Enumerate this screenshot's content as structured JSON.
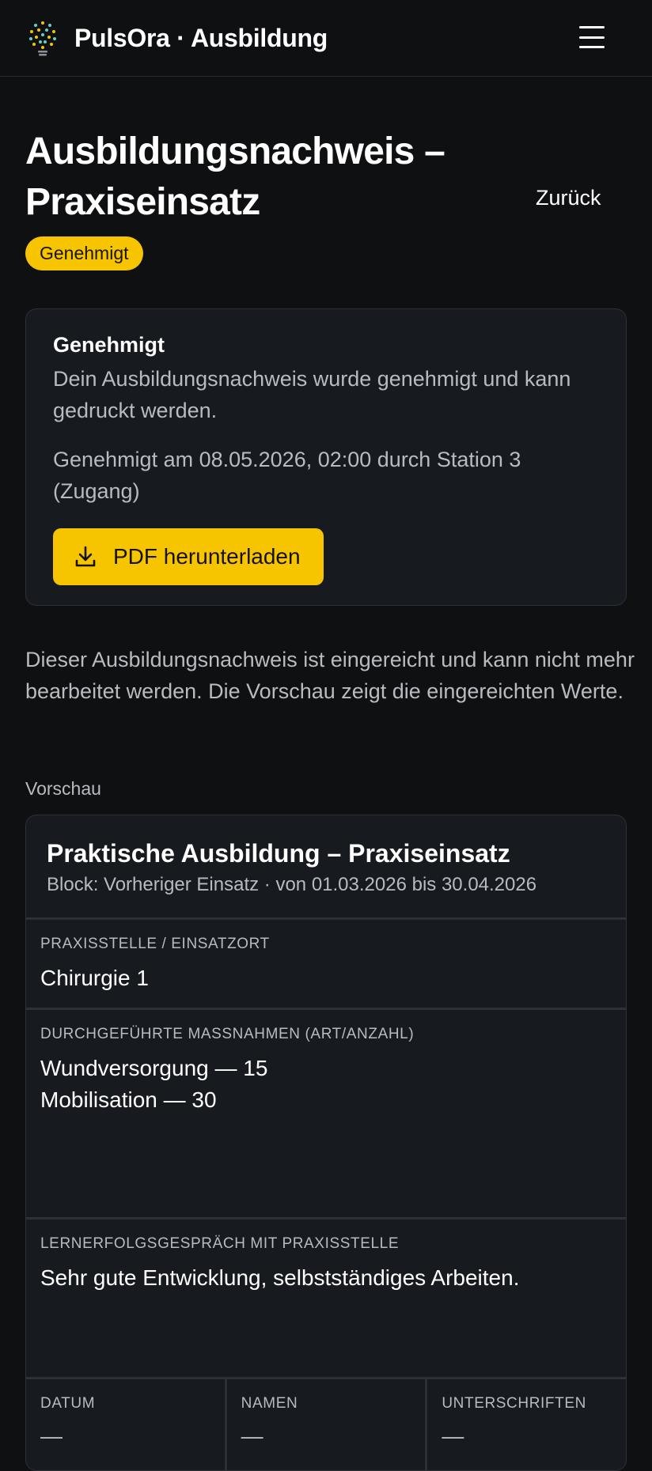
{
  "header": {
    "brand": "PulsOra · Ausbildung"
  },
  "page": {
    "title": "Ausbildungsnachweis – Praxiseinsatz",
    "back_label": "Zurück",
    "status_badge": "Genehmigt"
  },
  "approval_card": {
    "heading": "Genehmigt",
    "text": "Dein Ausbildungsnachweis wurde genehmigt und kann gedruckt werden.",
    "approved_info": "Genehmigt am 08.05.2026, 02:00 durch Station 3 (Zugang)",
    "download_label": "PDF herunterladen"
  },
  "info_text": "Dieser Ausbildungsnachweis ist eingereicht und kann nicht mehr bearbeitet werden. Die Vorschau zeigt die eingereichten Werte.",
  "preview": {
    "label": "Vorschau",
    "title": "Praktische Ausbildung – Praxiseinsatz",
    "subtitle": "Block: Vorheriger Einsatz · von 01.03.2026 bis 30.04.2026",
    "fields": [
      {
        "label": "Praxisstelle / Einsatzort",
        "value": "Chirurgie 1"
      },
      {
        "label": "Durchgeführte Maßnahmen (Art/Anzahl)",
        "value_lines": [
          "Wundversorgung — 15",
          "Mobilisation — 30"
        ]
      },
      {
        "label": "Lernerfolgsgespräch mit Praxisstelle",
        "value": "Sehr gute Entwicklung, selbstständiges Arbeiten."
      }
    ],
    "signature_columns": [
      {
        "label": "Datum",
        "value": "—"
      },
      {
        "label": "Namen",
        "value": "—"
      },
      {
        "label": "Unterschriften",
        "value": "—"
      }
    ]
  },
  "colors": {
    "background": "#0f1012",
    "card": "#171a1e",
    "accent": "#f7c400",
    "muted_text": "#b8bbc0"
  },
  "icons": {
    "logo": "lightbulb-logo-icon",
    "menu": "hamburger-menu-icon",
    "download": "download-icon"
  }
}
